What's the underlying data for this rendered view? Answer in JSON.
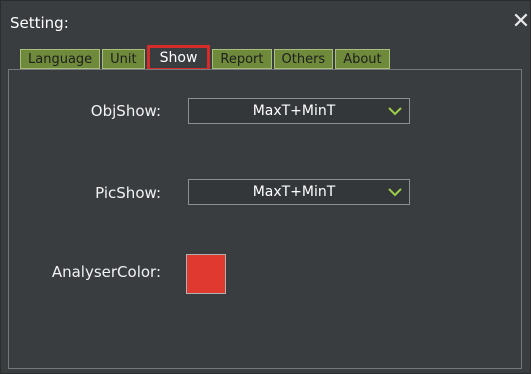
{
  "window": {
    "title": "Setting:",
    "close_glyph": "✕"
  },
  "tabs": [
    {
      "label": "Language",
      "active": false
    },
    {
      "label": "Unit",
      "active": false
    },
    {
      "label": "Show",
      "active": true
    },
    {
      "label": "Report",
      "active": false
    },
    {
      "label": "Others",
      "active": false
    },
    {
      "label": "About",
      "active": false
    }
  ],
  "show": {
    "obj_show": {
      "label": "ObjShow:",
      "value": "MaxT+MinT"
    },
    "pic_show": {
      "label": "PicShow:",
      "value": "MaxT+MinT"
    },
    "analyser_color": {
      "label": "AnalyserColor:",
      "color": "#e03a30"
    }
  },
  "colors": {
    "accent_green": "#9ccc4a",
    "tab_green": "#6f8a3a",
    "highlight_red": "#d52b2b"
  },
  "icons": {
    "close": "close-icon",
    "dropdown": "chevron-down-icon"
  }
}
